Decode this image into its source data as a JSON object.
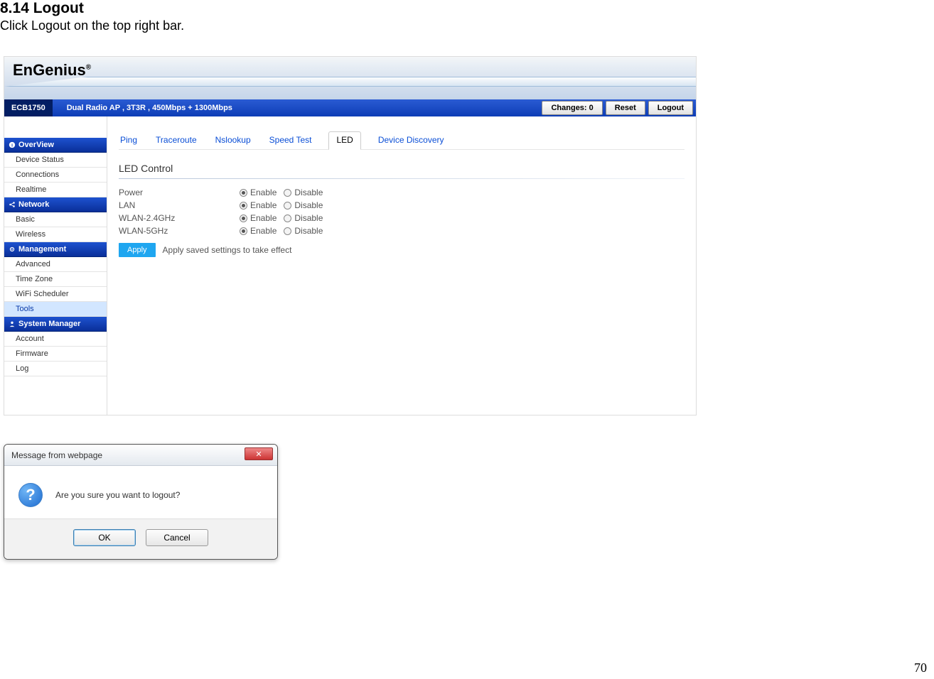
{
  "document": {
    "heading": "8.14 Logout",
    "subtext": "Click Logout on the top right bar.",
    "page_number": "70"
  },
  "router": {
    "logo": "EnGenius",
    "logo_reg": "®",
    "model": "ECB1750",
    "tagline": "Dual Radio AP , 3T3R , 450Mbps + 1300Mbps",
    "top_buttons": {
      "changes": "Changes: 0",
      "reset": "Reset",
      "logout": "Logout"
    },
    "sidebar": {
      "sections": [
        {
          "label": "OverView",
          "icon": "info",
          "items": [
            "Device Status",
            "Connections",
            "Realtime"
          ]
        },
        {
          "label": "Network",
          "icon": "share",
          "items": [
            "Basic",
            "Wireless"
          ]
        },
        {
          "label": "Management",
          "icon": "gear",
          "items": [
            "Advanced",
            "Time Zone",
            "WiFi Scheduler",
            "Tools"
          ],
          "active_item": "Tools"
        },
        {
          "label": "System Manager",
          "icon": "user",
          "items": [
            "Account",
            "Firmware",
            "Log"
          ]
        }
      ]
    },
    "tabs": [
      "Ping",
      "Traceroute",
      "Nslookup",
      "Speed Test",
      "LED",
      "Device Discovery"
    ],
    "active_tab": "LED",
    "section_title": "LED Control",
    "rows": [
      {
        "label": "Power",
        "value": "Enable"
      },
      {
        "label": "LAN",
        "value": "Enable"
      },
      {
        "label": "WLAN-2.4GHz",
        "value": "Enable"
      },
      {
        "label": "WLAN-5GHz",
        "value": "Enable"
      }
    ],
    "radio_options": {
      "enable": "Enable",
      "disable": "Disable"
    },
    "apply": {
      "button": "Apply",
      "text": "Apply saved settings to take effect"
    }
  },
  "dialog": {
    "title": "Message from webpage",
    "message": "Are you sure you want to logout?",
    "ok": "OK",
    "cancel": "Cancel"
  }
}
